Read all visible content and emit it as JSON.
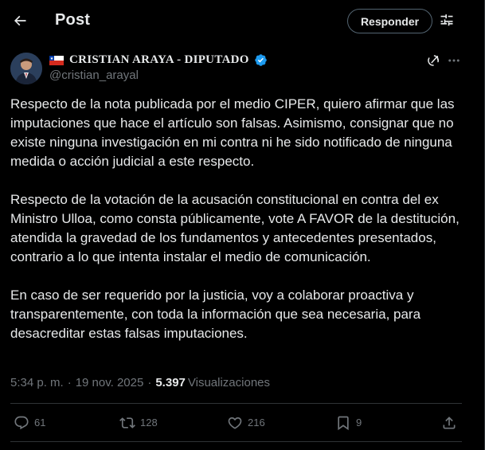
{
  "header": {
    "title": "Post",
    "reply_label": "Responder",
    "back_icon": "arrow-left-icon",
    "filter_icon": "sliders-icon"
  },
  "post": {
    "author_name": "CRISTIAN ARAYA - DIPUTADO",
    "handle": "@cristian_arayal",
    "flag_icon": "chile-flag-icon",
    "verified_color": "#1d9bf0",
    "paragraphs": [
      "Respecto de la nota publicada por el medio CIPER, quiero afirmar que las imputaciones que hace el artículo son falsas. Asimismo, consignar que no existe ninguna investigación en mi contra ni he sido notificado de ninguna medida o acción judicial a este respecto.",
      "Respecto de la votación de la acusación constitucional en contra del ex Ministro Ulloa, como consta públicamente, vote A FAVOR de la destitución, atendida la gravedad de los fundamentos y antecedentes presentados, contrario a lo que intenta instalar el medio de comunicación.",
      "En caso de ser requerido por la justicia, voy a colaborar proactiva y transparentemente, con toda la información que sea necesaria, para desacreditar estas falsas imputaciones."
    ],
    "time": "5:34 p. m.",
    "separator": "·",
    "date": "19 nov. 2025",
    "views_count": "5.397",
    "views_label": "Visualizaciones"
  },
  "actions": {
    "replies": "61",
    "reposts": "128",
    "likes": "216",
    "bookmarks": "9"
  },
  "colors": {
    "background": "#000000",
    "text": "#e7e9ea",
    "muted": "#71767b",
    "border": "#2f3336",
    "accent": "#1d9bf0"
  }
}
